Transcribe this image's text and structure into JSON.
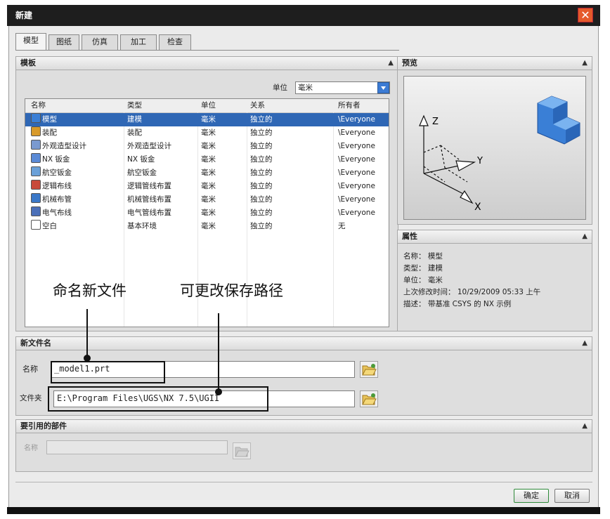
{
  "window": {
    "title": "新建",
    "close_symbol": "✕"
  },
  "tabs": [
    "模型",
    "图纸",
    "仿真",
    "加工",
    "检查"
  ],
  "templates": {
    "header": "模板",
    "unit_label": "单位",
    "unit_value": "毫米",
    "columns": [
      "名称",
      "类型",
      "单位",
      "关系",
      "所有者"
    ],
    "rows": [
      {
        "name": "模型",
        "type": "建模",
        "unit": "毫米",
        "relation": "独立的",
        "owner": "\\Everyone",
        "icon": "model-icon"
      },
      {
        "name": "装配",
        "type": "装配",
        "unit": "毫米",
        "relation": "独立的",
        "owner": "\\Everyone",
        "icon": "assembly-icon"
      },
      {
        "name": "外观造型设计",
        "type": "外观造型设计",
        "unit": "毫米",
        "relation": "独立的",
        "owner": "\\Everyone",
        "icon": "shape-studio-icon"
      },
      {
        "name": "NX 钣金",
        "type": "NX 钣金",
        "unit": "毫米",
        "relation": "独立的",
        "owner": "\\Everyone",
        "icon": "sheet-metal-icon"
      },
      {
        "name": "航空钣金",
        "type": "航空钣金",
        "unit": "毫米",
        "relation": "独立的",
        "owner": "\\Everyone",
        "icon": "aero-sheet-metal-icon"
      },
      {
        "name": "逻辑布线",
        "type": "逻辑管线布置",
        "unit": "毫米",
        "relation": "独立的",
        "owner": "\\Everyone",
        "icon": "logical-routing-icon"
      },
      {
        "name": "机械布管",
        "type": "机械管线布置",
        "unit": "毫米",
        "relation": "独立的",
        "owner": "\\Everyone",
        "icon": "mechanical-routing-icon"
      },
      {
        "name": "电气布线",
        "type": "电气管线布置",
        "unit": "毫米",
        "relation": "独立的",
        "owner": "\\Everyone",
        "icon": "electrical-routing-icon"
      },
      {
        "name": "空白",
        "type": "基本环境",
        "unit": "毫米",
        "relation": "独立的",
        "owner": "无",
        "icon": "blank-icon"
      }
    ]
  },
  "preview": {
    "header": "预览",
    "axis_z": "Z",
    "axis_y": "Y",
    "axis_x": "X"
  },
  "properties": {
    "header": "属性",
    "lines": [
      "名称： 模型",
      "类型： 建模",
      "单位： 毫米",
      "上次修改时间： 10/29/2009 05:33 上午",
      "描述： 带基准 CSYS 的 NX 示例"
    ]
  },
  "new_file": {
    "header": "新文件名",
    "name_label": "名称",
    "name_value": "_model1.prt",
    "folder_label": "文件夹",
    "folder_value": "E:\\Program Files\\UGS\\NX 7.5\\UGII"
  },
  "referenced": {
    "header": "要引用的部件",
    "name_label": "名称",
    "name_value": ""
  },
  "annotations": {
    "rename": "命名新文件",
    "change_path": "可更改保存路径"
  },
  "buttons": {
    "ok": "确定",
    "cancel": "取消"
  },
  "collapse_symbol": "▲"
}
